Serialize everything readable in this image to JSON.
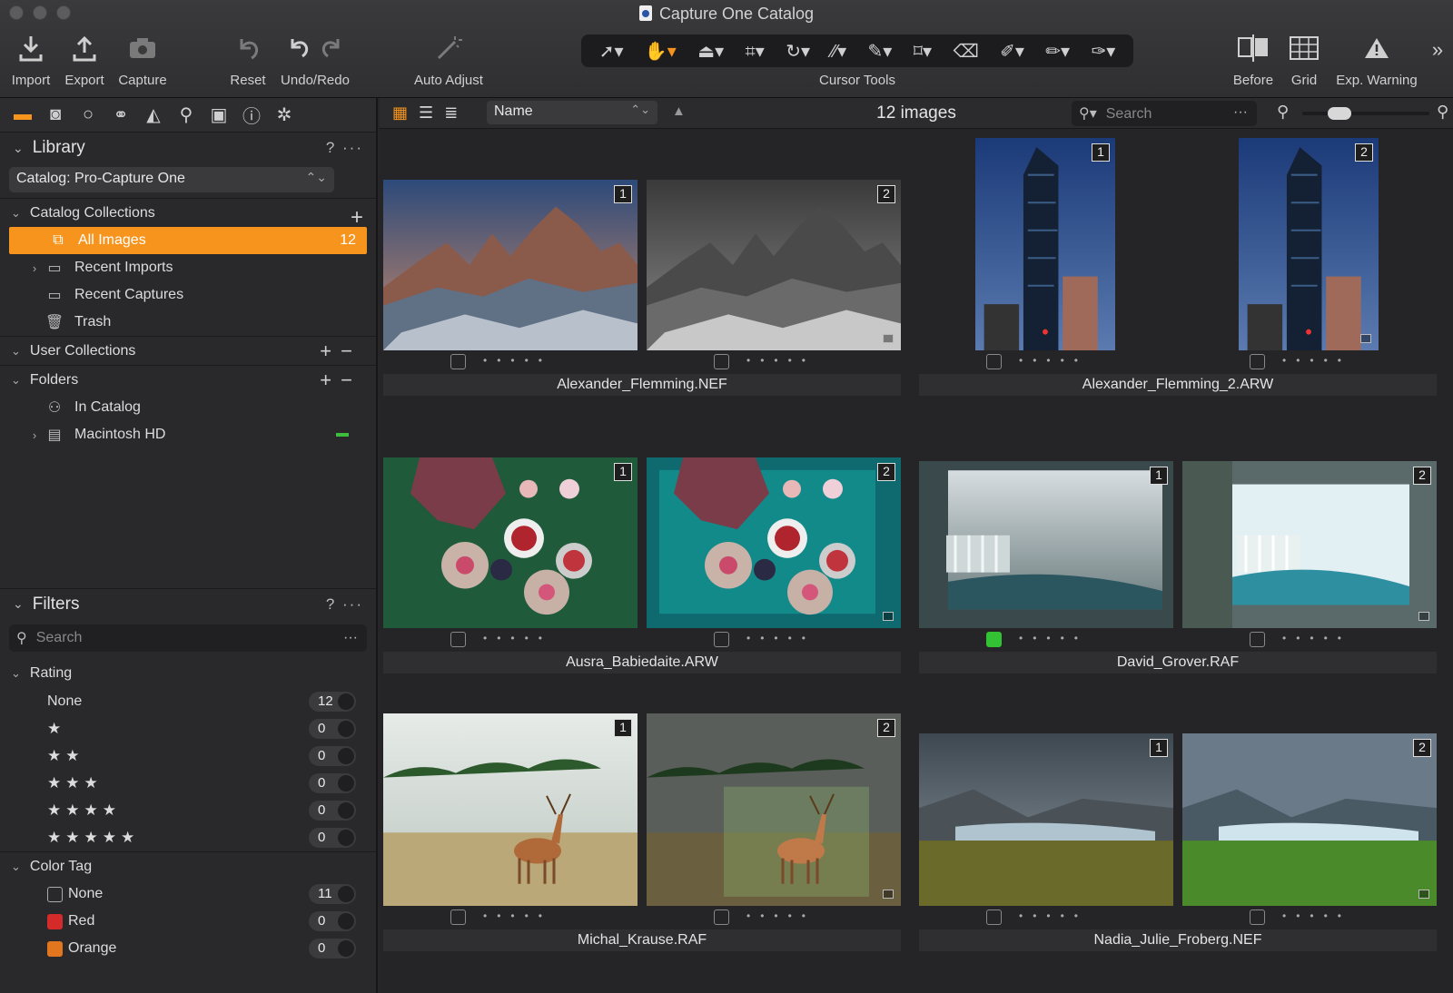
{
  "window": {
    "title": "Capture One Catalog"
  },
  "toolbar": {
    "import": "Import",
    "export": "Export",
    "capture": "Capture",
    "reset": "Reset",
    "undo_redo": "Undo/Redo",
    "auto_adjust": "Auto Adjust",
    "cursor_tools": "Cursor Tools",
    "before": "Before",
    "grid": "Grid",
    "exp_warning": "Exp. Warning"
  },
  "library": {
    "title": "Library",
    "help": "?",
    "more": "···",
    "catalog_select": "Catalog: Pro-Capture One",
    "catalog_collections": "Catalog Collections",
    "all_images": "All Images",
    "all_images_count": "12",
    "recent_imports": "Recent Imports",
    "recent_captures": "Recent Captures",
    "trash": "Trash",
    "user_collections": "User Collections",
    "folders": "Folders",
    "in_catalog": "In Catalog",
    "macintosh_hd": "Macintosh HD"
  },
  "filters": {
    "title": "Filters",
    "help": "?",
    "more": "···",
    "search_placeholder": "Search",
    "rating": "Rating",
    "rating_rows": [
      {
        "label": "None",
        "count": "12"
      },
      {
        "label": "★",
        "count": "0"
      },
      {
        "label": "★★",
        "count": "0"
      },
      {
        "label": "★★★",
        "count": "0"
      },
      {
        "label": "★★★★",
        "count": "0"
      },
      {
        "label": "★★★★★",
        "count": "0"
      }
    ],
    "color_tag": "Color Tag",
    "color_rows": [
      {
        "label": "None",
        "count": "11",
        "color": "transparent"
      },
      {
        "label": "Red",
        "count": "0",
        "color": "#d42a2a"
      },
      {
        "label": "Orange",
        "count": "0",
        "color": "#e2761f"
      }
    ]
  },
  "browser": {
    "sort": "Name",
    "image_count": "12 images",
    "search_placeholder": "Search",
    "groups": [
      {
        "name": "Alexander_Flemming.NEF"
      },
      {
        "name": "Alexander_Flemming_2.ARW"
      },
      {
        "name": "Ausra_Babiedaite.ARW"
      },
      {
        "name": "David_Grover.RAF"
      },
      {
        "name": "Michal_Krause.RAF"
      },
      {
        "name": "Nadia_Julie_Froberg.NEF"
      }
    ],
    "variant_1": "1",
    "variant_2": "2"
  },
  "colors": {
    "accent": "#f7941d",
    "green_tag": "#33c233"
  }
}
